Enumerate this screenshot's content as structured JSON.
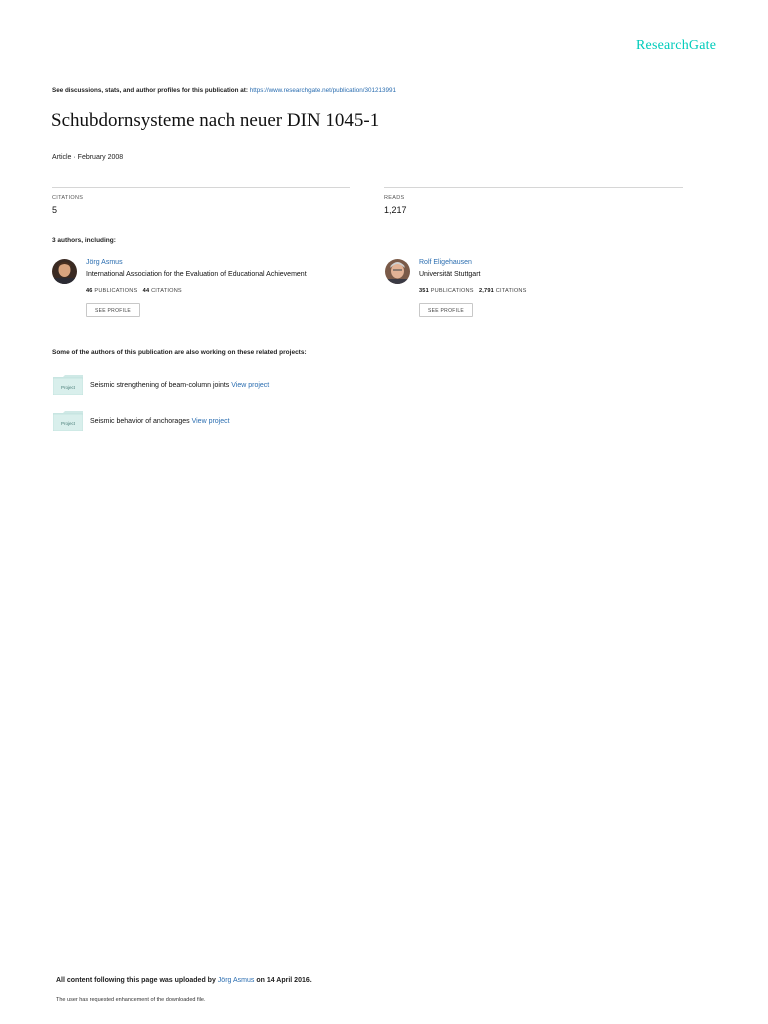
{
  "brand": {
    "name": "ResearchGate"
  },
  "header_note": {
    "text": "See discussions, stats, and author profiles for this publication at:",
    "url": "https://www.researchgate.net/publication/301213991"
  },
  "publication": {
    "title": "Schubdornsysteme nach neuer DIN 1045-1",
    "meta": "Article · February 2008"
  },
  "stats": {
    "citations_label": "CITATIONS",
    "citations_value": "5",
    "reads_label": "READS",
    "reads_value": "1,217"
  },
  "authors_heading": "3 authors, including:",
  "authors": [
    {
      "name": "Jörg Asmus",
      "institution": "International Association for the Evaluation of Educational Achievement",
      "publications": "46",
      "publications_label": "PUBLICATIONS",
      "citations": "44",
      "citations_label": "CITATIONS",
      "button": "SEE PROFILE"
    },
    {
      "name": "Rolf Eligehausen",
      "institution": "Universität Stuttgart",
      "publications": "351",
      "publications_label": "PUBLICATIONS",
      "citations": "2,791",
      "citations_label": "CITATIONS",
      "button": "SEE PROFILE"
    }
  ],
  "related_heading": "Some of the authors of this publication are also working on these related projects:",
  "projects": [
    {
      "icon_label": "Project",
      "title": "Seismic strengthening of beam-column joints",
      "link": "View project"
    },
    {
      "icon_label": "Project",
      "title": "Seismic behavior of anchorages",
      "link": "View project"
    }
  ],
  "footer": {
    "uploaded_prefix": "All content following this page was uploaded by",
    "uploader": "Jörg Asmus",
    "uploaded_suffix": "on 14 April 2016.",
    "note": "The user has requested enhancement of the downloaded file."
  },
  "colors": {
    "brand": "#00ccbb",
    "link": "#2a6db0",
    "project_icon": "#cfe9e6"
  }
}
